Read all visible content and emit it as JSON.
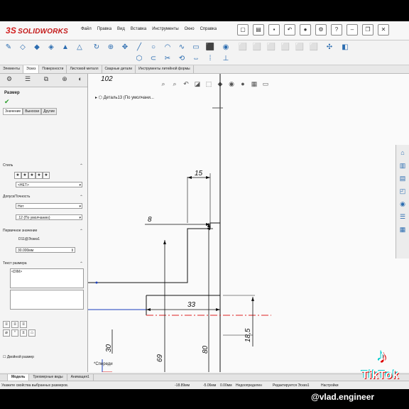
{
  "app": {
    "brand": "SOLIDWORKS",
    "brand_prefix": "3S"
  },
  "menu": [
    "Файл",
    "Правка",
    "Вид",
    "Вставка",
    "Инструменты",
    "Окно",
    "Справка"
  ],
  "command_tabs": [
    "Элементы",
    "Эскиз",
    "Поверхности",
    "Листовой металл",
    "Сварные детали",
    "Инструменты литейной формы"
  ],
  "active_command_tab": "Эскиз",
  "property_manager": {
    "title": "Размер",
    "subtabs": [
      "Значение",
      "Выноски",
      "Другие"
    ],
    "style_label": "Стиль",
    "style_value": "<НЕТ>",
    "tolerance_label": "Допуск/Точность",
    "tolerance_value": "Нет",
    "precision_value": ".12 (По умолчанию)",
    "primary_label": "Первичное значение",
    "primary_name": "D11@Эскиз1",
    "primary_value": "30.000мм",
    "text_label": "Текст размера",
    "text_value": "<DIM>",
    "dual_label": "Двойной размер"
  },
  "graphics": {
    "tree_label": "Деталь13 (По умолчани...",
    "sketch_label": "*Спереди",
    "top_dim": "102"
  },
  "chart_dims": {
    "d15": "15",
    "d8": "8",
    "d33": "33",
    "d69": "69",
    "d80": "80",
    "d30": "30",
    "d18_5": "18,5"
  },
  "model_tabs": [
    "",
    "Модель",
    "Трехмерные виды",
    "Анимация1"
  ],
  "active_model_tab": "Модель",
  "status": {
    "hint": "Укажите свойства выбранных размеров.",
    "x": "-18.89мм",
    "y": "-5.06мм",
    "z": "0.00мм",
    "state": "Недоопределен",
    "editing": "Редактируется Эскиз1",
    "settings": "Настройки"
  },
  "watermark": {
    "brand": "TikTok",
    "handle": "@vlad.engineer"
  },
  "colors": {
    "accent": "#2b6cb0",
    "brand": "#d32020",
    "sketch_line": "#111111",
    "selected_line": "#1a3fbf",
    "origin": "#1a3fbf"
  }
}
